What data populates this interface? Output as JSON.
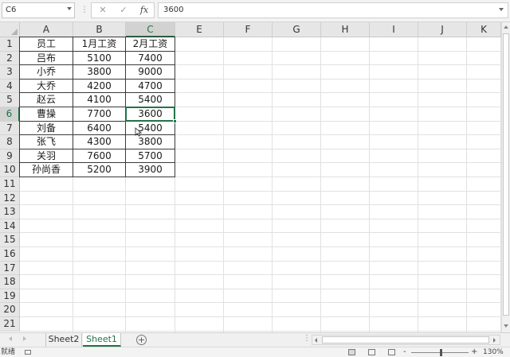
{
  "formula_bar": {
    "name_box": "C6",
    "separator": "⋮",
    "cancel_icon": "✕",
    "enter_icon": "✓",
    "fx_label": "fx",
    "formula_value": "3600"
  },
  "columns": [
    "A",
    "B",
    "C",
    "E",
    "F",
    "G",
    "H",
    "I",
    "J",
    "K"
  ],
  "rows": [
    "1",
    "2",
    "3",
    "4",
    "5",
    "6",
    "7",
    "8",
    "9",
    "10",
    "11",
    "12",
    "13",
    "14",
    "15",
    "16",
    "17",
    "18",
    "19",
    "20",
    "21"
  ],
  "table": {
    "headers": [
      "员工",
      "1月工资",
      "2月工资"
    ],
    "rows": [
      [
        "吕布",
        "5100",
        "7400"
      ],
      [
        "小乔",
        "3800",
        "9000"
      ],
      [
        "大乔",
        "4200",
        "4700"
      ],
      [
        "赵云",
        "4100",
        "5400"
      ],
      [
        "曹操",
        "7700",
        "3600"
      ],
      [
        "刘备",
        "6400",
        "5400"
      ],
      [
        "张飞",
        "4300",
        "3800"
      ],
      [
        "关羽",
        "7600",
        "5700"
      ],
      [
        "孙尚香",
        "5200",
        "3900"
      ]
    ]
  },
  "selected_cell": "C6",
  "sheets": {
    "tabs": [
      "Sheet2",
      "Sheet1"
    ],
    "active": "Sheet1",
    "add_label": "+",
    "dots": "⋮"
  },
  "status_bar": {
    "status": "就绪",
    "zoom_minus": "-",
    "zoom_plus": "+",
    "zoom": "130%"
  },
  "colors": {
    "accent": "#217346",
    "table_border": "#3a3a3a",
    "header_bg": "#e6e6e6"
  },
  "icons": [
    "cancel-icon",
    "check-icon",
    "fx-icon",
    "add-sheet-icon",
    "macro-icon",
    "normal-view-icon",
    "page-layout-icon",
    "page-break-icon"
  ]
}
